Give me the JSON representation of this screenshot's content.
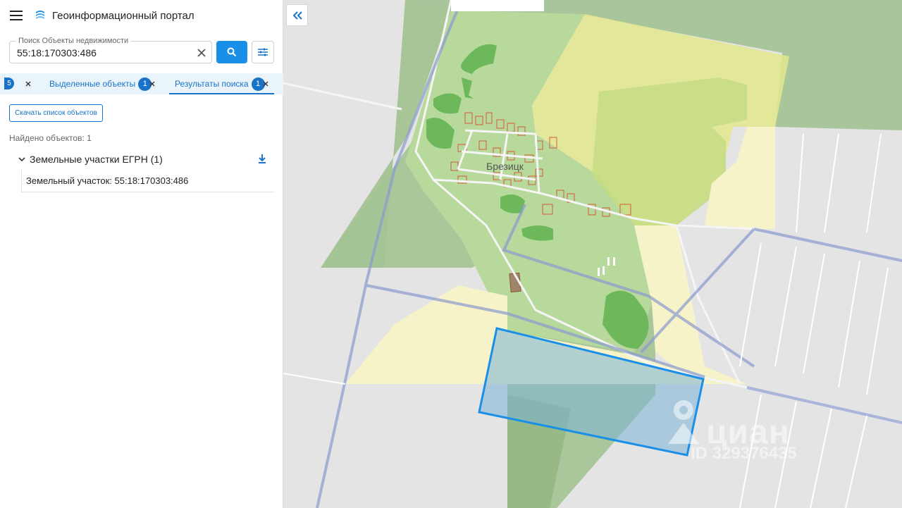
{
  "header": {
    "title": "Геоинформационный портал"
  },
  "search": {
    "legend": "Поиск Объекты недвижимости",
    "value": "55:18:170303:486"
  },
  "tabs": [
    {
      "label": "",
      "count": "5"
    },
    {
      "label": "Выделенные объекты",
      "count": "1"
    },
    {
      "label": "Результаты поиска",
      "count": "1"
    }
  ],
  "results": {
    "download_label": "Скачать список объектов",
    "found_text": "Найдено объектов: 1",
    "group_title": "Земельные участки ЕГРН (1)",
    "item_label": "Земельный участок: 55:18:170303:486"
  },
  "map": {
    "village_name": "Брезицк",
    "watermark_brand": "циан",
    "watermark_id": "ID 329376435"
  },
  "colors": {
    "accent": "#1a73c8",
    "search_button": "#1a8fe8",
    "highlight": "#1a8fe8"
  }
}
